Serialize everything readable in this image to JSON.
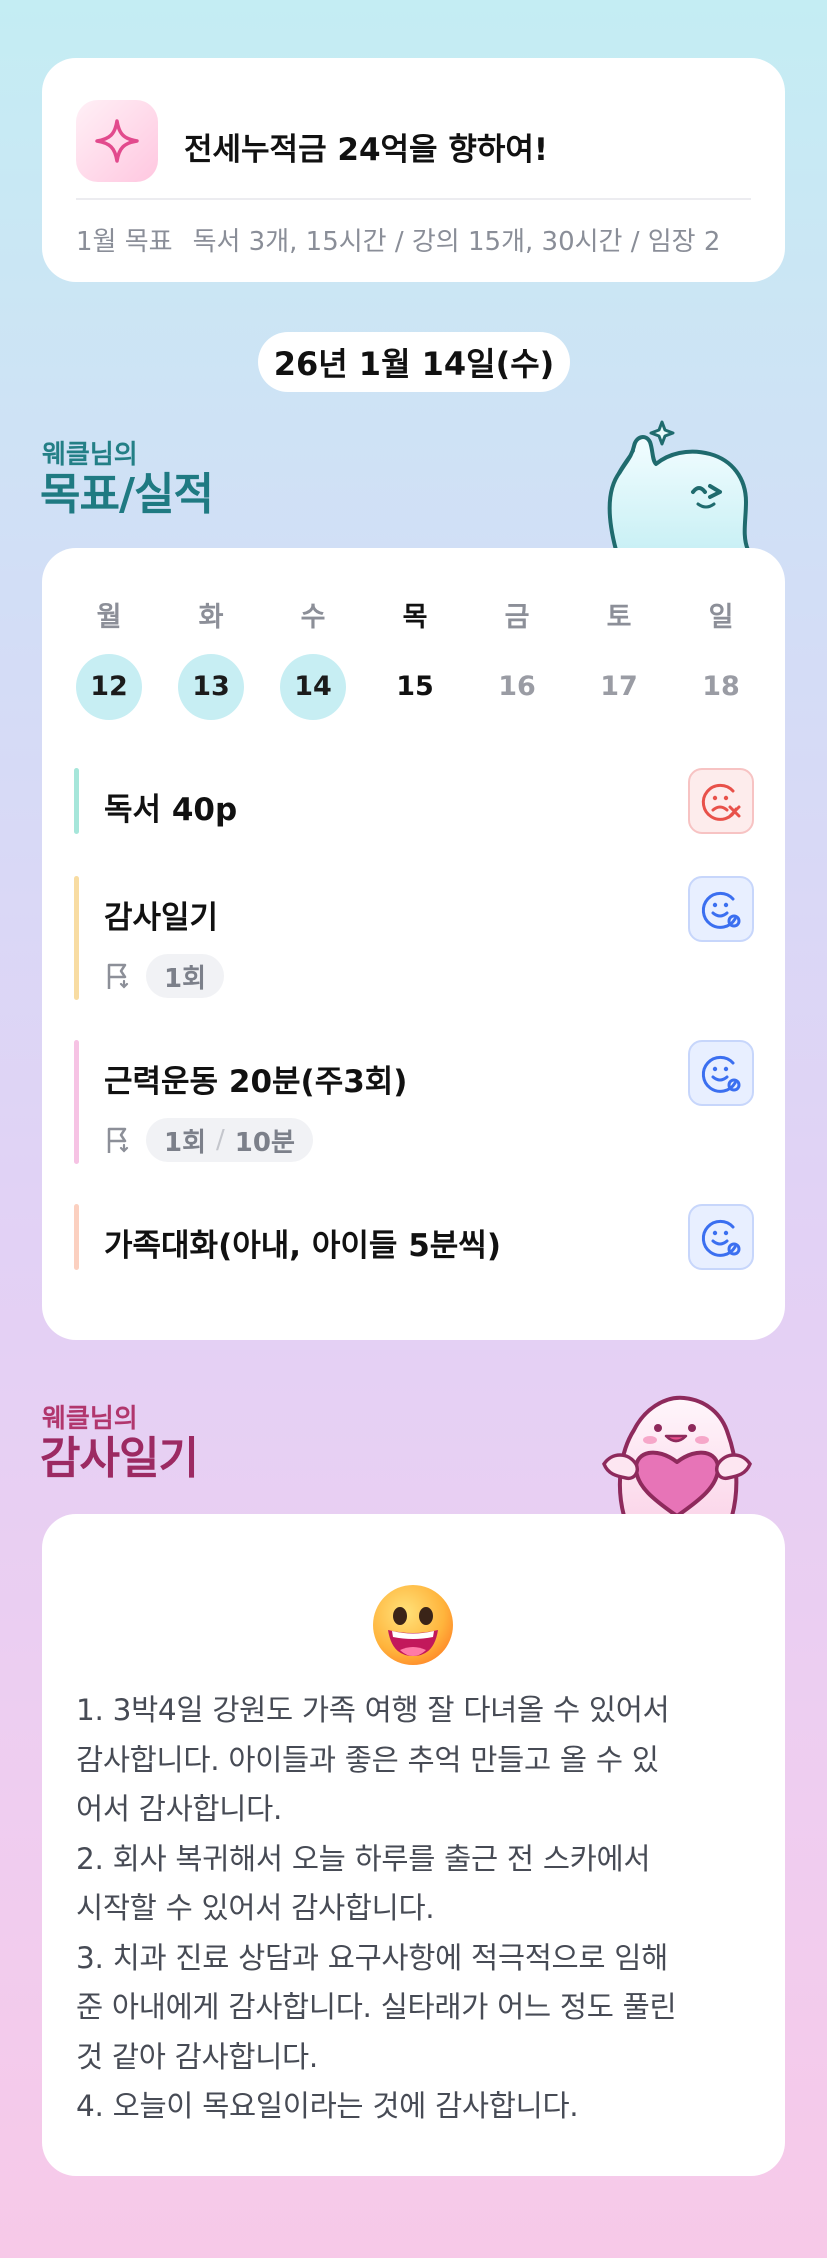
{
  "goal_header": {
    "title": "전세누적금 24억을 향하여!",
    "monthly_label": "1월 목표",
    "monthly_goals": "독서 3개, 15시간 / 강의 15개, 30시간 / 임장 2"
  },
  "date": "26년 1월 14일(수)",
  "goals_section": {
    "subtitle": "웨클님의",
    "title": "목표/실적"
  },
  "week": [
    {
      "day": "월",
      "date": "12",
      "state": "done"
    },
    {
      "day": "화",
      "date": "13",
      "state": "done"
    },
    {
      "day": "수",
      "date": "14",
      "state": "done"
    },
    {
      "day": "목",
      "date": "15",
      "state": "today"
    },
    {
      "day": "금",
      "date": "16",
      "state": "future"
    },
    {
      "day": "토",
      "date": "17",
      "state": "future"
    },
    {
      "day": "일",
      "date": "18",
      "state": "future"
    }
  ],
  "tasks": [
    {
      "name": "독서 40p",
      "status": "fail",
      "bar_color": "#a6e6da"
    },
    {
      "name": "감사일기",
      "count": "1회",
      "status": "ok",
      "bar_color": "#f8dca2"
    },
    {
      "name": "근력운동 20분(주3회)",
      "count": "1회",
      "duration": "10분",
      "status": "ok",
      "bar_color": "#f6c3e4"
    },
    {
      "name": "가족대화(아내, 아이들 5분씩)",
      "status": "ok",
      "bar_color": "#fbd0c0"
    }
  ],
  "diary_section": {
    "subtitle": "웨클님의",
    "title": "감사일기"
  },
  "diary_lines": [
    "1. 3박4일 강원도 가족 여행 잘 다녀올 수 있어서",
    "감사합니다. 아이들과 좋은 추억 만들고 올 수 있",
    "어서 감사합니다.",
    "2. 회사 복귀해서 오늘 하루를 출근 전 스카에서",
    "시작할 수 있어서 감사합니다.",
    "3. 치과 진료 상담과 요구사항에 적극적으로 임해",
    "준 아내에게 감사합니다. 실타래가 어느 정도 풀린",
    "것 같아 감사합니다.",
    "4. 오늘이 목요일이라는 것에 감사합니다."
  ],
  "colors": {
    "goals_title": "#1f7a82",
    "diary_title": "#9c2a62",
    "done_circle": "#c7eef3",
    "fail_icon": "#e8514a",
    "ok_icon": "#3b6ff0"
  },
  "icons": {
    "goal": "sparkle-icon",
    "count": "flag-icon",
    "fail": "sad-face-x-icon",
    "ok": "smile-face-check-icon",
    "diary": "grinning-face-emoji"
  }
}
